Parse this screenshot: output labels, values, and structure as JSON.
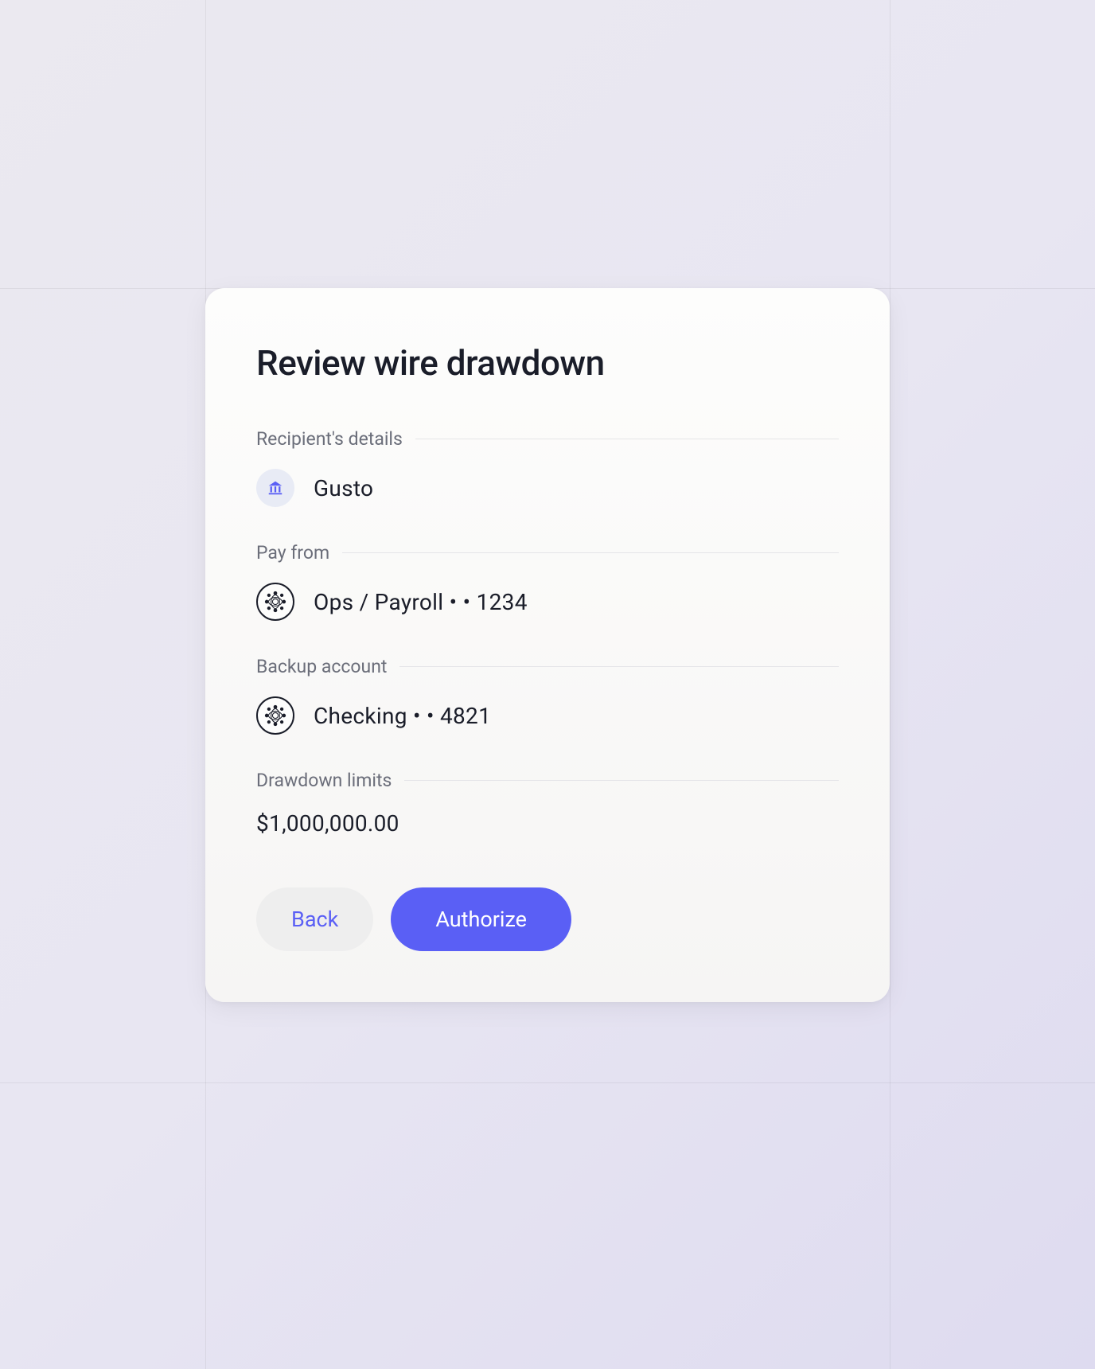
{
  "title": "Review wire drawdown",
  "sections": {
    "recipient": {
      "label": "Recipient's details",
      "name": "Gusto"
    },
    "pay_from": {
      "label": "Pay from",
      "account": "Ops / Payroll  • • 1234"
    },
    "backup": {
      "label": "Backup account",
      "account": "Checking  • • 4821"
    },
    "limits": {
      "label": "Drawdown limits",
      "amount": "$1,000,000.00"
    }
  },
  "buttons": {
    "back": "Back",
    "authorize": "Authorize"
  }
}
